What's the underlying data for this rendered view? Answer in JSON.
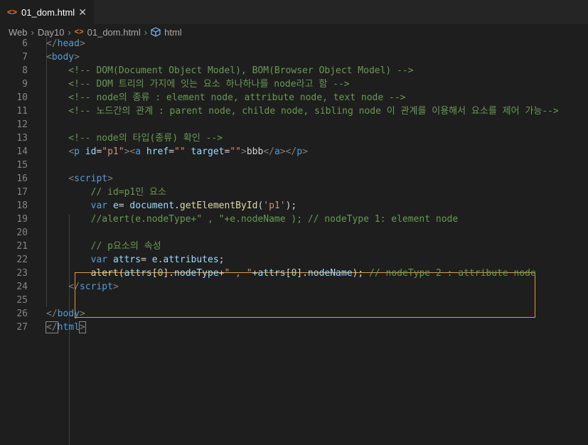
{
  "tab": {
    "label": "01_dom.html",
    "close": "✕"
  },
  "breadcrumb": {
    "crumb1": "Web",
    "crumb2": "Day10",
    "file": "01_dom.html",
    "symbol": "html"
  },
  "code_lines": [
    {
      "n": "6",
      "tokens": [
        [
          "br",
          "</"
        ],
        [
          "tag",
          "head"
        ],
        [
          "br",
          ">"
        ]
      ]
    },
    {
      "n": "7",
      "tokens": [
        [
          "br",
          "<"
        ],
        [
          "tag",
          "body"
        ],
        [
          "br",
          ">"
        ]
      ]
    },
    {
      "n": "8",
      "tokens": [
        [
          "com",
          "    <!-- DOM(Document Object Model), BOM(Browser Object Model) -->"
        ]
      ]
    },
    {
      "n": "9",
      "tokens": [
        [
          "com",
          "    <!-- DOM 트리의 가지에 잇는 요소 하나하나를 node라고 함 -->"
        ]
      ]
    },
    {
      "n": "10",
      "tokens": [
        [
          "com",
          "    <!-- node의 종류 : element node, attribute node, text node -->"
        ]
      ]
    },
    {
      "n": "11",
      "tokens": [
        [
          "com",
          "    <!-- 노드간의 관계 : parent node, childe node, sibling node 이 관계를 이용해서 요소를 제어 가능-->"
        ]
      ]
    },
    {
      "n": "12",
      "tokens": []
    },
    {
      "n": "13",
      "tokens": [
        [
          "com",
          "    <!-- node의 타입(종류) 확인 -->"
        ]
      ]
    },
    {
      "n": "14",
      "tokens": [
        [
          "txt",
          "    "
        ],
        [
          "br",
          "<"
        ],
        [
          "tag",
          "p"
        ],
        [
          "txt",
          " "
        ],
        [
          "attr",
          "id"
        ],
        [
          "txt",
          "="
        ],
        [
          "str",
          "\"p1\""
        ],
        [
          "br",
          ">"
        ],
        [
          "br",
          "<"
        ],
        [
          "tag",
          "a"
        ],
        [
          "txt",
          " "
        ],
        [
          "attr",
          "href"
        ],
        [
          "txt",
          "="
        ],
        [
          "str",
          "\"\""
        ],
        [
          "txt",
          " "
        ],
        [
          "attr",
          "target"
        ],
        [
          "txt",
          "="
        ],
        [
          "str",
          "\"\""
        ],
        [
          "br",
          ">"
        ],
        [
          "txt",
          "bbb"
        ],
        [
          "br",
          "</"
        ],
        [
          "tag",
          "a"
        ],
        [
          "br",
          ">"
        ],
        [
          "br",
          "</"
        ],
        [
          "tag",
          "p"
        ],
        [
          "br",
          ">"
        ]
      ]
    },
    {
      "n": "15",
      "tokens": []
    },
    {
      "n": "16",
      "tokens": [
        [
          "txt",
          "    "
        ],
        [
          "br",
          "<"
        ],
        [
          "tag",
          "script"
        ],
        [
          "br",
          ">"
        ]
      ]
    },
    {
      "n": "17",
      "tokens": [
        [
          "com",
          "        // id=p1인 요소"
        ]
      ]
    },
    {
      "n": "18",
      "tokens": [
        [
          "txt",
          "        "
        ],
        [
          "kw",
          "var"
        ],
        [
          "txt",
          " "
        ],
        [
          "var",
          "e"
        ],
        [
          "txt",
          "= "
        ],
        [
          "var",
          "document"
        ],
        [
          "txt",
          "."
        ],
        [
          "fn",
          "getElementById"
        ],
        [
          "txt",
          "("
        ],
        [
          "str",
          "'p1'"
        ],
        [
          "txt",
          ");"
        ]
      ]
    },
    {
      "n": "19",
      "tokens": [
        [
          "com",
          "        //alert(e.nodeType+\" , \"+e.nodeName ); // nodeType 1: element node"
        ]
      ]
    },
    {
      "n": "20",
      "tokens": []
    },
    {
      "n": "21",
      "tokens": [
        [
          "com",
          "        // p요소의 속성"
        ]
      ]
    },
    {
      "n": "22",
      "tokens": [
        [
          "txt",
          "        "
        ],
        [
          "kw",
          "var"
        ],
        [
          "txt",
          " "
        ],
        [
          "var",
          "attrs"
        ],
        [
          "txt",
          "= "
        ],
        [
          "var",
          "e"
        ],
        [
          "txt",
          "."
        ],
        [
          "var",
          "attributes"
        ],
        [
          "txt",
          ";"
        ]
      ]
    },
    {
      "n": "23",
      "tokens": [
        [
          "txt",
          "        "
        ],
        [
          "fn",
          "alert"
        ],
        [
          "txt",
          "("
        ],
        [
          "var",
          "attrs"
        ],
        [
          "txt",
          "["
        ],
        [
          "num",
          "0"
        ],
        [
          "txt",
          "]."
        ],
        [
          "var",
          "nodeType"
        ],
        [
          "txt",
          "+"
        ],
        [
          "str",
          "\" , \""
        ],
        [
          "txt",
          "+"
        ],
        [
          "var",
          "attrs"
        ],
        [
          "txt",
          "["
        ],
        [
          "num",
          "0"
        ],
        [
          "txt",
          "]."
        ],
        [
          "var",
          "nodeName"
        ],
        [
          "txt",
          ");"
        ],
        [
          "com",
          " // nodeType 2 : attribute node"
        ]
      ]
    },
    {
      "n": "24",
      "tokens": [
        [
          "txt",
          "    "
        ],
        [
          "br",
          "</"
        ],
        [
          "tag",
          "script"
        ],
        [
          "br",
          ">"
        ]
      ]
    },
    {
      "n": "25",
      "tokens": []
    },
    {
      "n": "26",
      "tokens": [
        [
          "br",
          "</"
        ],
        [
          "tag",
          "body"
        ],
        [
          "br",
          ">"
        ]
      ]
    },
    {
      "n": "27",
      "tokens": [
        [
          "brk",
          "</"
        ],
        [
          "tag",
          "html"
        ],
        [
          "brk",
          ">"
        ]
      ]
    }
  ]
}
